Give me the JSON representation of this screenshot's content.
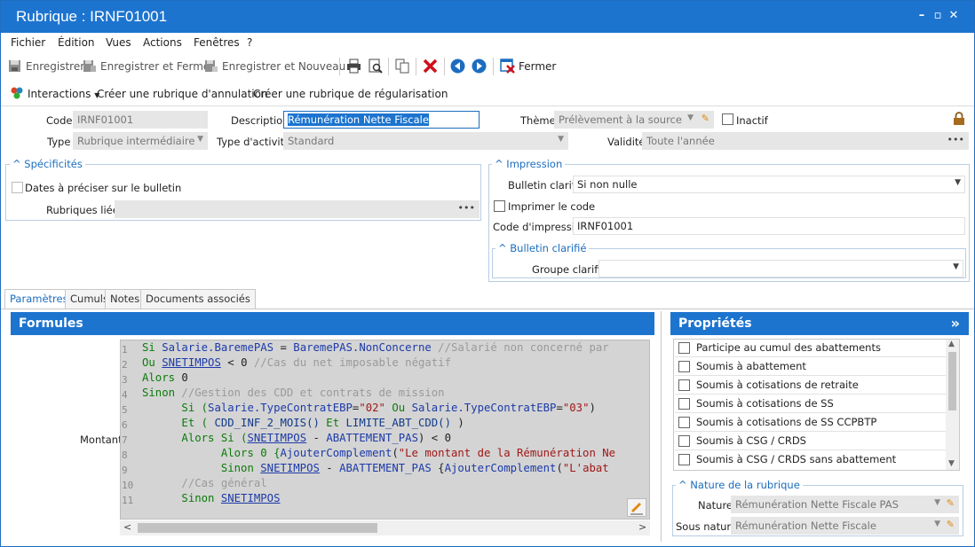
{
  "window": {
    "title": "Rubrique : IRNF01001"
  },
  "menu": [
    "Fichier",
    "Édition",
    "Vues",
    "Actions",
    "Fenêtres",
    "?"
  ],
  "toolbar": {
    "save": "Enregistrer",
    "save_close": "Enregistrer et Fermer",
    "save_new": "Enregistrer et Nouveau",
    "close": "Fermer"
  },
  "actions": {
    "interactions": "Interactions",
    "cancel_rubric": "Créer une rubrique d'annulation",
    "regul_rubric": "Créer une rubrique de régularisation"
  },
  "form": {
    "code_label": "Code",
    "code_value": "IRNF01001",
    "description_label": "Description",
    "description_value": "Rémunération Nette Fiscale",
    "theme_label": "Thème",
    "theme_value": "Prélèvement à la source",
    "inactif_label": "Inactif",
    "type_label": "Type",
    "type_value": "Rubrique intermédiaire",
    "activity_label": "Type d'activité",
    "activity_value": "Standard",
    "validity_label": "Validité",
    "validity_value": "Toute l'année"
  },
  "specificites": {
    "title": "Spécificités",
    "dates_label": "Dates à préciser sur le bulletin",
    "linked_label": "Rubriques liées"
  },
  "impression": {
    "title": "Impression",
    "bulletin_label": "Bulletin clarifié",
    "bulletin_value": "Si non nulle",
    "print_code_label": "Imprimer le code",
    "code_label": "Code d'impression",
    "code_value": "IRNF01001",
    "sub_title": "Bulletin clarifié",
    "group_label": "Groupe clarifié",
    "group_value": ""
  },
  "tabs": [
    "Paramètres",
    "Cumuls",
    "Notes",
    "Documents associés"
  ],
  "formules": {
    "title": "Formules",
    "montant_label": "Montant",
    "lines": [
      "1",
      "2",
      "3",
      "4",
      "5",
      "6",
      "7",
      "8",
      "9",
      "10",
      "11"
    ]
  },
  "code": {
    "l1": [
      "Si ",
      "Salarie.BaremePAS",
      " = ",
      "BaremePAS.NonConcerne",
      " //Salarié non concerné par"
    ],
    "l2": [
      "Ou ",
      "SNETIMPOS",
      " < 0 ",
      "//Cas du net imposable négatif"
    ],
    "l3": [
      "Alors ",
      "0"
    ],
    "l4": [
      "Sinon ",
      "//Gestion des CDD et contrats de mission"
    ],
    "l5": [
      "      Si (",
      "Salarie.TypeContratEBP",
      "=",
      "\"02\"",
      " Ou ",
      "Salarie.TypeContratEBP",
      "=",
      "\"03\"",
      ")"
    ],
    "l6": [
      "      Et ( ",
      "CDD_INF_2_MOIS()",
      " Et ",
      "LIMITE_ABT_CDD()",
      " )"
    ],
    "l7": [
      "      Alors Si (",
      "SNETIMPOS",
      " - ",
      "ABATTEMENT_PAS",
      ") < 0"
    ],
    "l8": [
      "            Alors 0 {",
      "AjouterComplement",
      "(",
      "\"Le montant de la Rémunération Ne"
    ],
    "l9": [
      "            Sinon ",
      "SNETIMPOS",
      " - ",
      "ABATTEMENT_PAS",
      " {",
      "AjouterComplement",
      "(",
      "\"L'abat"
    ],
    "l10": [
      "      //Cas général"
    ],
    "l11": [
      "      Sinon ",
      "SNETIMPOS"
    ]
  },
  "proprietes": {
    "title": "Propriétés",
    "items": [
      "Participe au cumul des abattements",
      "Soumis à abattement",
      "Soumis à cotisations de retraite",
      "Soumis à cotisations de SS",
      "Soumis à cotisations de SS CCPBTP",
      "Soumis à CSG / CRDS",
      "Soumis à CSG / CRDS sans abattement"
    ]
  },
  "nature": {
    "title": "Nature de la rubrique",
    "nature_label": "Nature",
    "nature_value": "Rémunération Nette Fiscale PAS",
    "sous_label": "Sous nature",
    "sous_value": "Rémunération Nette Fiscale"
  },
  "colors": {
    "accent": "#1c74cf",
    "group_title": "#1c6dbf",
    "code_bg": "#d4d4d4"
  }
}
